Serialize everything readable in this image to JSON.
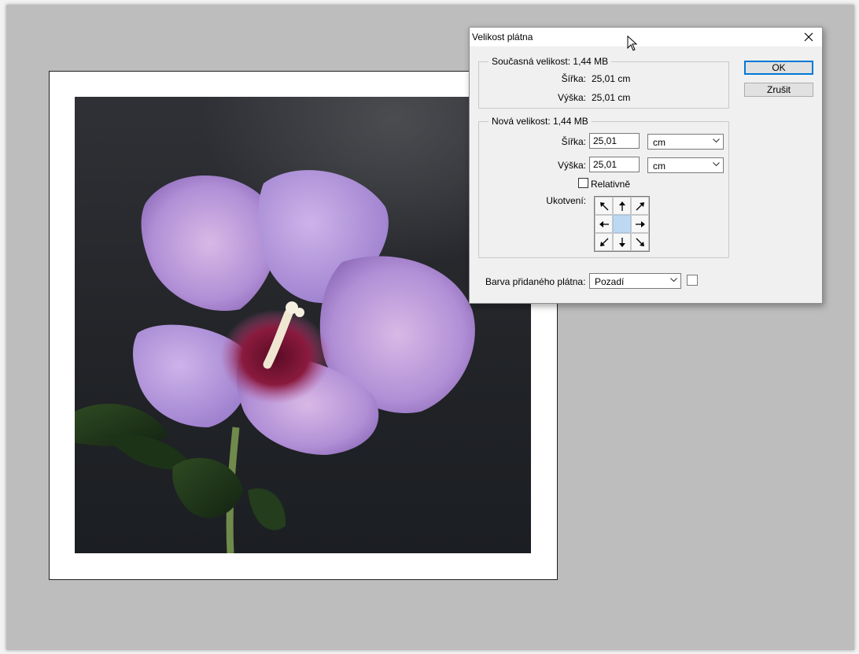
{
  "dialog": {
    "title": "Velikost plátna",
    "ok_label": "OK",
    "cancel_label": "Zrušit",
    "current_size": {
      "legend": "Současná velikost: 1,44 MB",
      "width_label": "Šířka:",
      "width_value": "25,01 cm",
      "height_label": "Výška:",
      "height_value": "25,01 cm"
    },
    "new_size": {
      "legend": "Nová velikost: 1,44 MB",
      "width_label": "Šířka:",
      "width_value": "25,01",
      "width_unit": "cm",
      "height_label": "Výška:",
      "height_value": "25,01",
      "height_unit": "cm",
      "relative_label": "Relativně",
      "relative_checked": false,
      "anchor_label": "Ukotvení:"
    },
    "extension_color": {
      "label": "Barva přidaného plátna:",
      "value": "Pozadí",
      "swatch_color": "#ffffff"
    }
  },
  "colors": {
    "workspace": "#bdbdbd",
    "accent": "#0078d7",
    "anchor_selected": "#bdd9f2"
  }
}
